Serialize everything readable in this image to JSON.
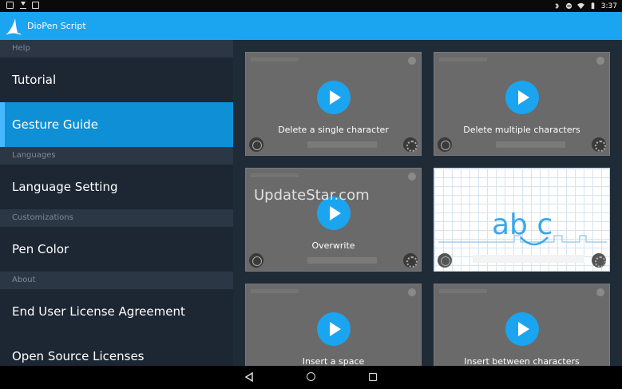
{
  "status_bar": {
    "time": "3:37"
  },
  "app": {
    "title": "DioPen Script"
  },
  "sidebar": {
    "sections": [
      {
        "header": "Help",
        "items": [
          {
            "label": "Tutorial"
          },
          {
            "label": "Gesture Guide",
            "active": true
          }
        ]
      },
      {
        "header": "Languages",
        "items": [
          {
            "label": "Language Setting"
          }
        ]
      },
      {
        "header": "Customizations",
        "items": [
          {
            "label": "Pen Color"
          }
        ]
      },
      {
        "header": "About",
        "items": [
          {
            "label": "End User License Agreement"
          },
          {
            "label": "Open Source Licenses"
          }
        ]
      }
    ]
  },
  "gestures": [
    {
      "caption": "Delete a single character"
    },
    {
      "caption": "Delete multiple characters"
    },
    {
      "caption": "Overwrite"
    },
    {
      "caption": "",
      "handwriting": "ab c"
    },
    {
      "caption": "Insert a space"
    },
    {
      "caption": "Insert between characters"
    }
  ],
  "watermark": "UpdateStar.com",
  "colors": {
    "accent": "#1ba5f0",
    "active": "#0f8fd6",
    "sidebar_bg": "#1c2733",
    "section_bg": "#2b3744"
  }
}
